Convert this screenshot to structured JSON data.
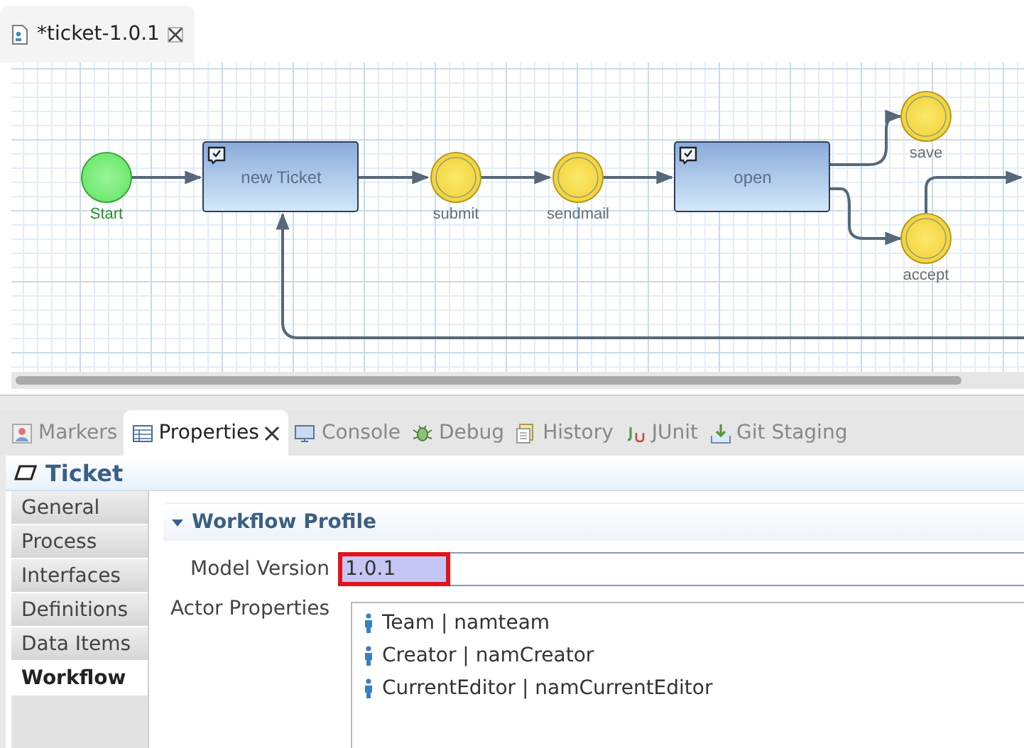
{
  "editor_tabs": [
    {
      "title": "*ticket-1.0.1",
      "selected": true
    }
  ],
  "diagram": {
    "nodes": [
      {
        "kind": "start",
        "label": "Start"
      },
      {
        "kind": "task",
        "label": "new Ticket"
      },
      {
        "kind": "event",
        "label": "submit"
      },
      {
        "kind": "event",
        "label": "sendmail"
      },
      {
        "kind": "task",
        "label": "open"
      },
      {
        "kind": "event",
        "label": "save"
      },
      {
        "kind": "event",
        "label": "accept"
      }
    ]
  },
  "view_tabs": [
    {
      "label": "Markers",
      "selected": false
    },
    {
      "label": "Properties",
      "selected": true
    },
    {
      "label": "Console",
      "selected": false
    },
    {
      "label": "Debug",
      "selected": false
    },
    {
      "label": "History",
      "selected": false
    },
    {
      "label": "JUnit",
      "selected": false
    },
    {
      "label": "Git Staging",
      "selected": false
    }
  ],
  "properties": {
    "title": "Ticket",
    "sections": [
      {
        "label": "General",
        "selected": false
      },
      {
        "label": "Process",
        "selected": false
      },
      {
        "label": "Interfaces",
        "selected": false
      },
      {
        "label": "Definitions",
        "selected": false
      },
      {
        "label": "Data Items",
        "selected": false
      },
      {
        "label": "Workflow",
        "selected": true
      }
    ],
    "profile": {
      "title": "Workflow Profile",
      "expanded": true,
      "model_version": {
        "label": "Model Version",
        "value": "1.0.1",
        "highlighted": true
      },
      "actor_properties": {
        "label": "Actor Properties",
        "items": [
          {
            "text": "Team | namteam"
          },
          {
            "text": "Creator | namCreator"
          },
          {
            "text": "CurrentEditor | namCurrentEditor"
          }
        ]
      }
    }
  }
}
